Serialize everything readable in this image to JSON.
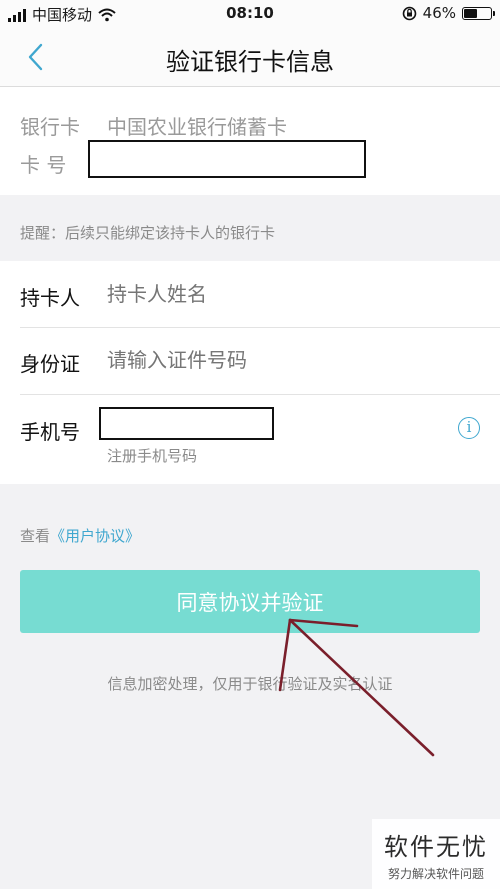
{
  "status_bar": {
    "carrier": "中国移动",
    "time": "08:10",
    "battery": "46%",
    "battery_level": 0.46
  },
  "nav": {
    "title": "验证银行卡信息",
    "back_icon": "chevron-left-icon"
  },
  "card_info": {
    "bank_label": "银行卡",
    "bank_value": "中国农业银行储蓄卡",
    "number_label": "卡 号"
  },
  "tip": "提醒：后续只能绑定该持卡人的银行卡",
  "form": {
    "holder_label": "持卡人",
    "holder_placeholder": "持卡人姓名",
    "id_label": "身份证",
    "id_placeholder": "请输入证件号码",
    "phone_label": "手机号",
    "phone_hint": "注册手机号码",
    "info_icon": "info-icon"
  },
  "agreement": {
    "prefix": "查看",
    "link": "《用户协议》"
  },
  "submit_label": "同意协议并验证",
  "privacy_note": "信息加密处理，仅用于银行验证及实名认证",
  "watermark": {
    "title": "软件无忧",
    "subtitle": "努力解决软件问题"
  },
  "colors": {
    "accent": "#3fa7cf",
    "button": "#77dcd2",
    "annotation": "#7a1f2b"
  }
}
